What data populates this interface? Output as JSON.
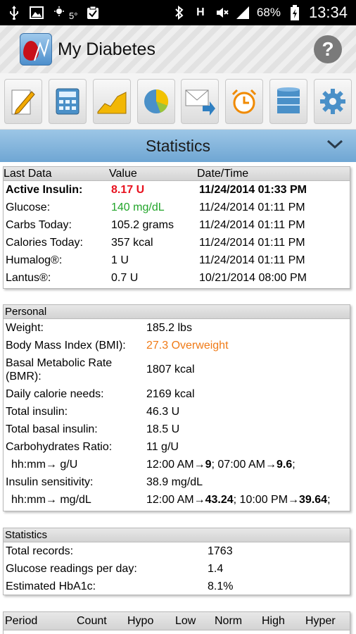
{
  "status_bar": {
    "temperature": "5°",
    "battery_percent": "68%",
    "time": "13:34",
    "icons": [
      "usb-icon",
      "image-icon",
      "weather-icon",
      "clipboard-check-icon",
      "bluetooth-icon",
      "signal-h-icon",
      "mute-icon",
      "cell-signal-icon",
      "battery-charging-icon"
    ]
  },
  "app": {
    "title": "My Diabetes",
    "help_label": "?"
  },
  "toolbar": {
    "items": [
      "edit-icon",
      "calculator-icon",
      "chart-icon",
      "pie-chart-icon",
      "export-mail-icon",
      "alarm-icon",
      "database-icon",
      "settings-icon"
    ]
  },
  "section": {
    "title": "Statistics"
  },
  "last_data": {
    "headers": [
      "Last Data",
      "Value",
      "Date/Time"
    ],
    "rows": [
      {
        "label": "Active Insulin:",
        "value": "8.17 U",
        "datetime": "11/24/2014 01:33 PM"
      },
      {
        "label": "Glucose:",
        "value": "140 mg/dL",
        "datetime": "11/24/2014 01:11 PM"
      },
      {
        "label": "Carbs Today:",
        "value": "105.2 grams",
        "datetime": "11/24/2014 01:11 PM"
      },
      {
        "label": "Calories Today:",
        "value": "357 kcal",
        "datetime": "11/24/2014 01:11 PM"
      },
      {
        "label": "Humalog®:",
        "value": "1 U",
        "datetime": "11/24/2014 01:11 PM"
      },
      {
        "label": "Lantus®:",
        "value": "0.7 U",
        "datetime": "10/21/2014 08:00 PM"
      }
    ]
  },
  "personal": {
    "header": "Personal",
    "rows": [
      {
        "label": "Weight:",
        "value": "185.2 lbs"
      },
      {
        "label": "Body Mass Index (BMI):",
        "value": "27.3 Overweight"
      },
      {
        "label": "Basal Metabolic Rate (BMR):",
        "value": "1807 kcal"
      },
      {
        "label": "Daily calorie needs:",
        "value": "2169 kcal"
      },
      {
        "label": "Total insulin:",
        "value": "46.3 U"
      },
      {
        "label": "Total basal insulin:",
        "value": "18.5 U"
      },
      {
        "label": "Carbohydrates Ratio:",
        "value": "11 g/U"
      }
    ],
    "carb_ratio_sub": {
      "label": "hh:mm→ g/U",
      "t1": "12:00 AM",
      "v1": "9",
      "t2": "07:00 AM",
      "v2": "9.6"
    },
    "insulin_sensitivity": {
      "label": "Insulin sensitivity:",
      "value": "38.9 mg/dL"
    },
    "sensitivity_sub": {
      "label": "hh:mm→ mg/dL",
      "t1": "12:00 AM",
      "v1": "43.24",
      "t2": "10:00 PM",
      "v2": "39.64"
    }
  },
  "statistics": {
    "header": "Statistics",
    "rows": [
      {
        "label": "Total records:",
        "value": "1763"
      },
      {
        "label": "Glucose readings per day:",
        "value": "1.4"
      },
      {
        "label": "Estimated HbA1c:",
        "value": "8.1%"
      }
    ]
  },
  "periods": {
    "headers": [
      "Period",
      "Count",
      "Hypo",
      "Low",
      "Norm",
      "High",
      "Hyper"
    ]
  },
  "colors": {
    "active_insulin": "#e8121f",
    "glucose": "#22a52a",
    "bmi": "#f07a16",
    "section_header": "#8cbde3"
  }
}
